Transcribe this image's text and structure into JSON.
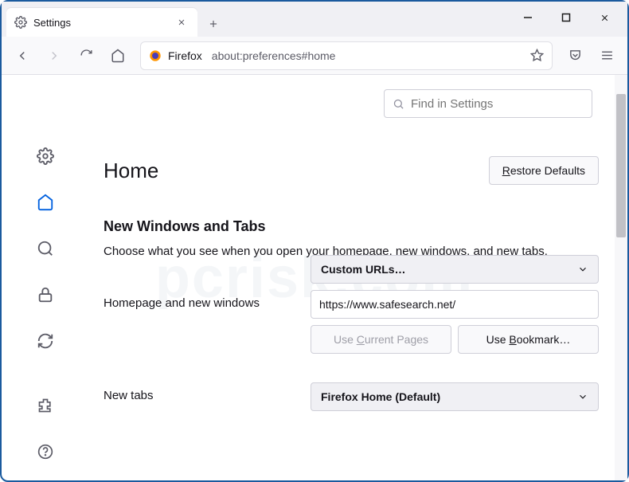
{
  "tab": {
    "label": "Settings"
  },
  "urlbar": {
    "brand": "Firefox",
    "address": "about:preferences#home"
  },
  "search": {
    "placeholder": "Find in Settings"
  },
  "page": {
    "title": "Home",
    "restore_label": "Restore Defaults",
    "restore_key": "R"
  },
  "section": {
    "title": "New Windows and Tabs",
    "desc": "Choose what you see when you open your homepage, new windows, and new tabs."
  },
  "homepage": {
    "label": "Homepage and new windows",
    "select_value": "Custom URLs…",
    "url_value": "https://www.safesearch.net/",
    "use_current": "Use Current Pages",
    "use_current_key": "C",
    "use_bookmark": "Use Bookmark…",
    "use_bookmark_key": "B"
  },
  "newtabs": {
    "label": "New tabs",
    "select_value": "Firefox Home (Default)"
  },
  "watermark": "pcrisk.com"
}
